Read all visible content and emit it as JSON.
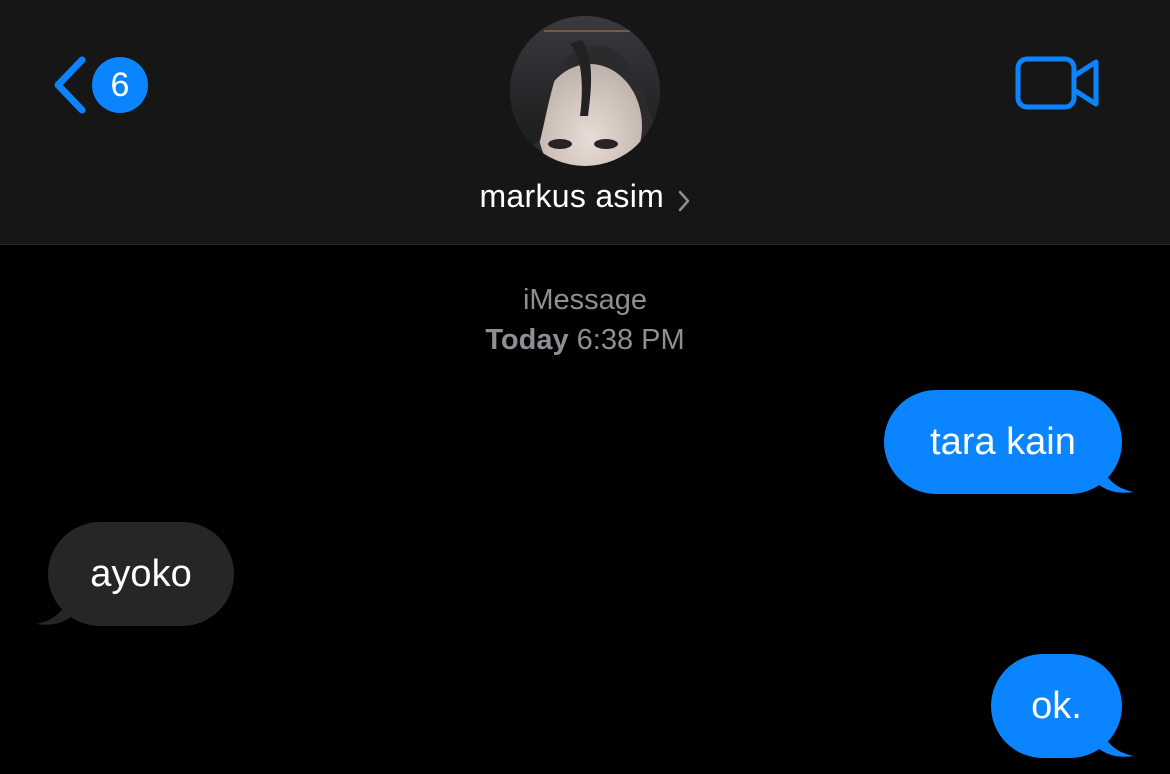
{
  "header": {
    "back": {
      "icon": "chevron-left-icon",
      "unread_count": "6"
    },
    "contact": {
      "name": "markus asim",
      "avatar": "contact-photo",
      "chevron_icon": "chevron-right-icon"
    },
    "video_icon": "video-camera-icon"
  },
  "conversation": {
    "service": "iMessage",
    "timestamp_day": "Today",
    "timestamp_time": "6:38 PM",
    "messages": [
      {
        "direction": "sent",
        "text": "tara kain"
      },
      {
        "direction": "received",
        "text": "ayoko"
      },
      {
        "direction": "sent",
        "text": "ok."
      }
    ]
  },
  "colors": {
    "accent": "#0a84ff",
    "header_bg": "#161616",
    "background": "#000000",
    "received_bubble": "#262628",
    "meta_text": "#8e8e93"
  }
}
